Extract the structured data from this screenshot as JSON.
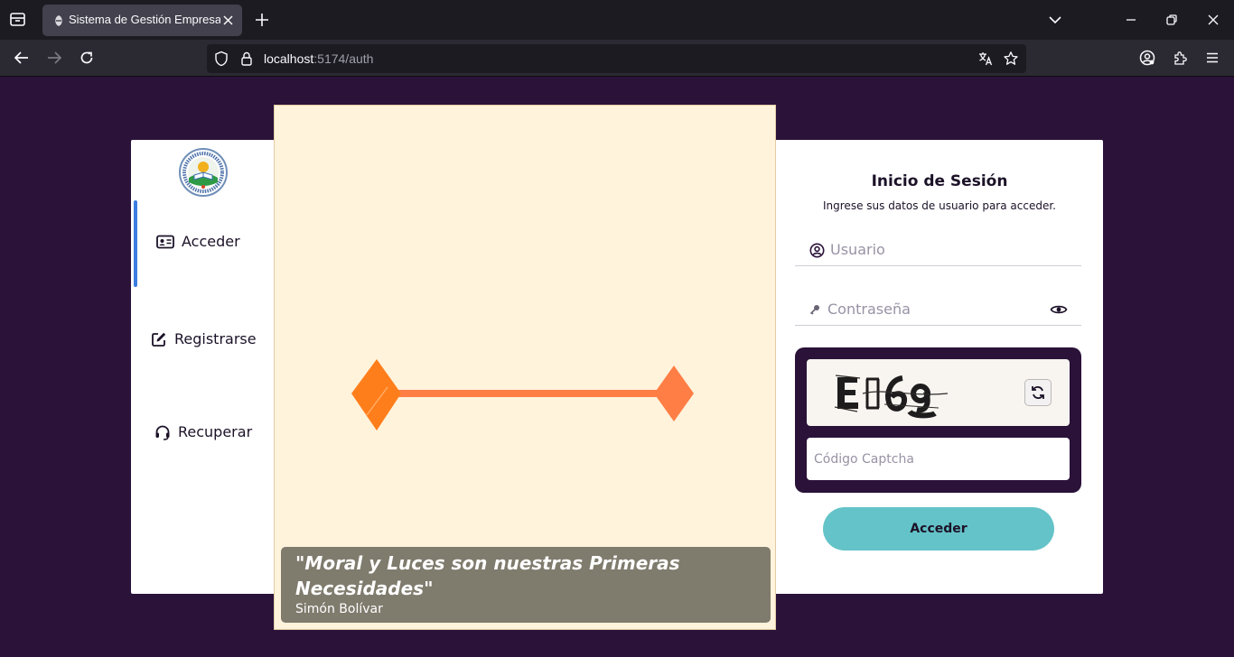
{
  "browser": {
    "tab_title": "Sistema de Gestión Empresarial",
    "url_host": "localhost",
    "url_path": ":5174/auth"
  },
  "sidebar": {
    "items": [
      {
        "label": "Acceder",
        "icon": "id-card-icon",
        "active": true
      },
      {
        "label": "Registrarse",
        "icon": "edit-icon",
        "active": false
      },
      {
        "label": "Recuperar",
        "icon": "headset-icon",
        "active": false
      }
    ]
  },
  "image_panel": {
    "quote": "\"Moral y Luces son nuestras Primeras Necesidades\"",
    "author": "Simón Bolívar",
    "colors": {
      "background": "#fff3dc",
      "accent": "#ff7a2a"
    }
  },
  "login": {
    "title": "Inicio de Sesión",
    "subtitle": "Ingrese sus datos de usuario para acceder.",
    "username_placeholder": "Usuario",
    "password_placeholder": "Contraseña",
    "captcha_placeholder": "Código Captcha",
    "captcha_text": "E]6g",
    "submit_label": "Acceder",
    "colors": {
      "dark": "#2a1239",
      "button": "#64c3c8"
    }
  }
}
